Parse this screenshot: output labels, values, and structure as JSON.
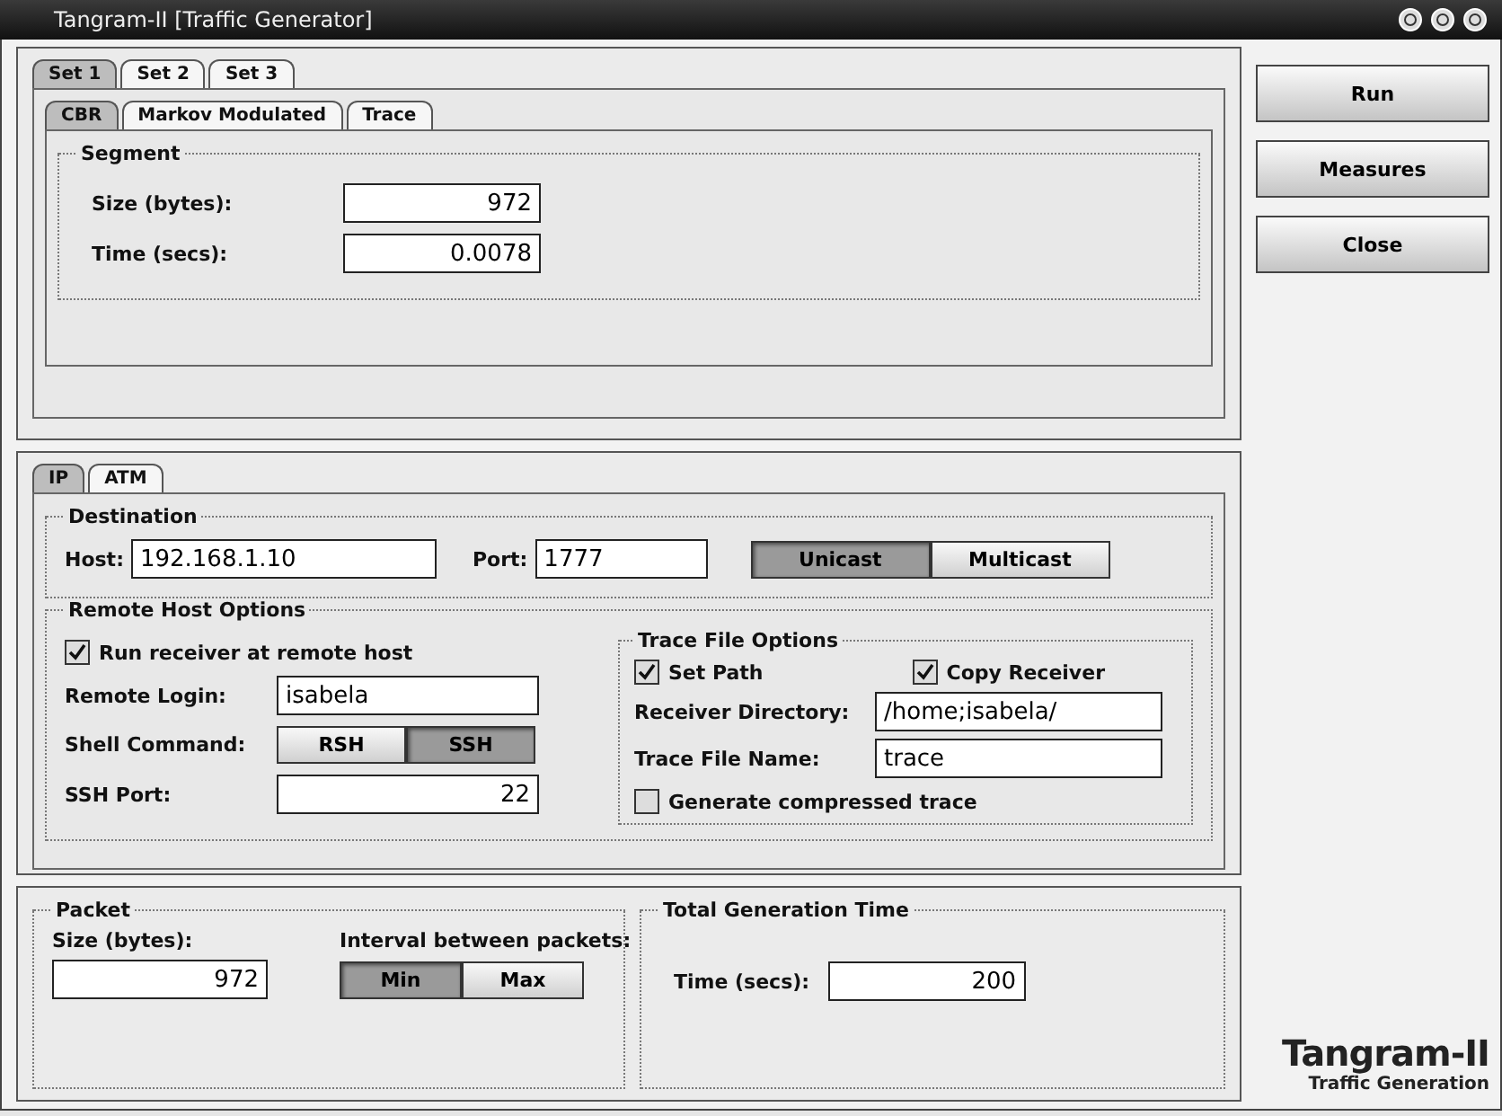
{
  "window": {
    "title": "Tangram-II [Traffic Generator]"
  },
  "traffic_sets": {
    "tabs": [
      {
        "label": "Set 1",
        "selected": true
      },
      {
        "label": "Set 2",
        "selected": false
      },
      {
        "label": "Set 3",
        "selected": false
      }
    ],
    "source_tabs": [
      {
        "label": "CBR",
        "selected": true
      },
      {
        "label": "Markov Modulated",
        "selected": false
      },
      {
        "label": "Trace",
        "selected": false
      }
    ],
    "segment": {
      "title": "Segment",
      "fields": [
        {
          "label": "Size (bytes):",
          "value": "972"
        },
        {
          "label": "Time (secs):",
          "value": "0.0078"
        }
      ]
    }
  },
  "actions": [
    {
      "label": "Run"
    },
    {
      "label": "Measures"
    },
    {
      "label": "Close"
    }
  ],
  "network": {
    "tabs": [
      {
        "label": "IP",
        "selected": true
      },
      {
        "label": "ATM",
        "selected": false
      }
    ],
    "destination": {
      "title": "Destination",
      "host_label": "Host:",
      "host": "192.168.1.10",
      "port_label": "Port:",
      "port": "1777",
      "modes": [
        {
          "label": "Unicast",
          "selected": true
        },
        {
          "label": "Multicast",
          "selected": false
        }
      ]
    },
    "remote_host": {
      "title": "Remote Host Options",
      "run_receiver": {
        "label": "Run receiver at remote host",
        "checked": true
      },
      "login_label": "Remote Login:",
      "login": "isabela",
      "shell_label": "Shell Command:",
      "shells": [
        {
          "label": "RSH",
          "selected": false
        },
        {
          "label": "SSH",
          "selected": true
        }
      ],
      "ssh_port_label": "SSH Port:",
      "ssh_port": "22"
    },
    "trace_options": {
      "title": "Trace File Options",
      "set_path": {
        "label": "Set Path",
        "checked": true
      },
      "copy_receiver": {
        "label": "Copy Receiver",
        "checked": true
      },
      "dir_label": "Receiver Directory:",
      "dir": "/home;isabela/",
      "name_label": "Trace File Name:",
      "name": "trace",
      "compressed": {
        "label": "Generate compressed trace",
        "checked": false
      }
    }
  },
  "packet": {
    "title": "Packet",
    "size_label": "Size (bytes):",
    "size": "972",
    "interval_label": "Interval between packets:",
    "intervals": [
      {
        "label": "Min",
        "selected": true
      },
      {
        "label": "Max",
        "selected": false
      }
    ]
  },
  "total_time": {
    "title": "Total Generation Time",
    "time_label": "Time (secs):",
    "time": "200"
  },
  "logo": {
    "title": "Tangram-II",
    "subtitle": "Traffic Generation"
  }
}
